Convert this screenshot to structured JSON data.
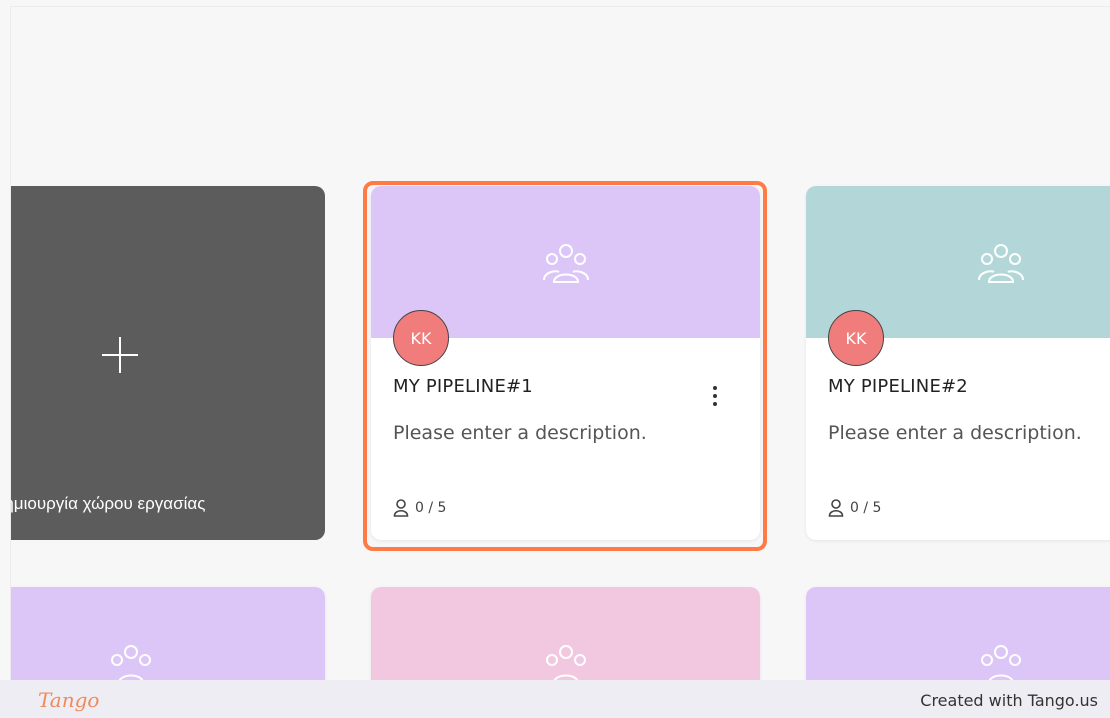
{
  "workspace_grid": {
    "create_card": {
      "label": "Δημιουργία χώρου εργασίας",
      "icon": "plus-icon"
    },
    "cards": [
      {
        "title": "MY PIPELINE#1",
        "description": "Please enter a description.",
        "avatar_initials": "KK",
        "members": "0 / 5",
        "banner_color": "#dcc5f7",
        "icon": "team-icon",
        "selected": true
      },
      {
        "title": "MY PIPELINE#2",
        "description": "Please enter a description.",
        "avatar_initials": "KK",
        "members": "0 / 5",
        "banner_color": "#b3d7d8",
        "icon": "team-icon",
        "selected": false
      }
    ],
    "second_row_banner_colors": [
      "#dcc5f7",
      "#f1c8e0",
      "#dcc5f7"
    ]
  },
  "colors": {
    "highlight": "#ff7a45",
    "avatar": "#f07c7c",
    "create_card": "#5c5c5c"
  },
  "footer": {
    "logo": "Tango",
    "credit": "Created with Tango.us"
  }
}
